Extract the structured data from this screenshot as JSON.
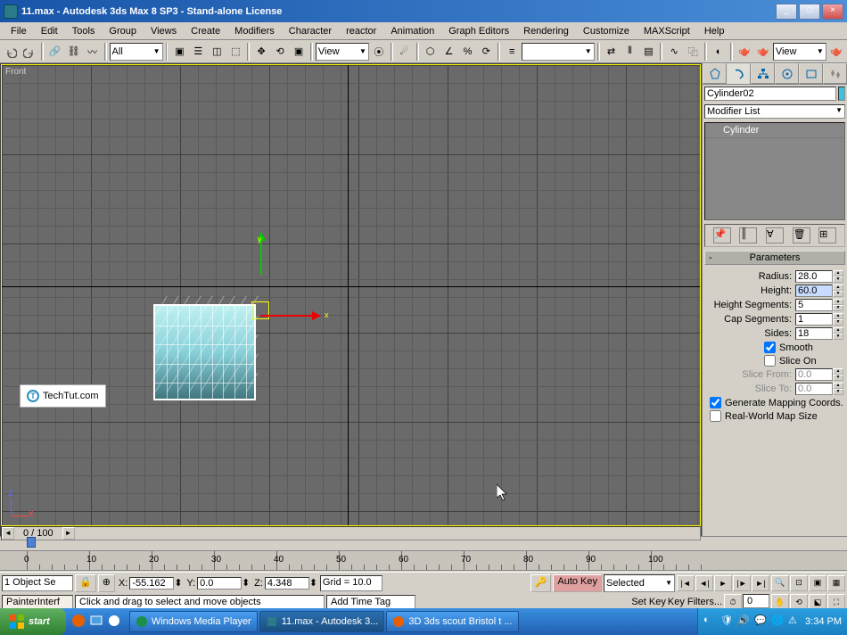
{
  "window": {
    "title": "11.max - Autodesk 3ds Max 8 SP3  - Stand-alone License"
  },
  "menu": [
    "File",
    "Edit",
    "Tools",
    "Group",
    "Views",
    "Create",
    "Modifiers",
    "Character",
    "reactor",
    "Animation",
    "Graph Editors",
    "Rendering",
    "Customize",
    "MAXScript",
    "Help"
  ],
  "toolbar": {
    "selection_filter": "All",
    "refcoord": "View",
    "view_mode": "View"
  },
  "viewport": {
    "label": "Front",
    "watermark": "TechTut.com"
  },
  "axis": {
    "x": "x",
    "y": "y",
    "z": "z"
  },
  "scrollbar": {
    "pos": "0 / 100"
  },
  "cmdpanel": {
    "object_name": "Cylinder02",
    "modifier_list_label": "Modifier List",
    "stack_item": "Cylinder",
    "rollout_title": "Parameters",
    "params": {
      "radius_lbl": "Radius:",
      "radius": "28.0",
      "height_lbl": "Height:",
      "height": "60.0",
      "hseg_lbl": "Height Segments:",
      "hseg": "5",
      "cseg_lbl": "Cap Segments:",
      "cseg": "1",
      "sides_lbl": "Sides:",
      "sides": "18",
      "smooth_lbl": "Smooth",
      "sliceon_lbl": "Slice On",
      "sfrom_lbl": "Slice From:",
      "sfrom": "0.0",
      "sto_lbl": "Slice To:",
      "sto": "0.0",
      "genmap_lbl": "Generate Mapping Coords.",
      "realworld_lbl": "Real-World Map Size"
    }
  },
  "timeline": {
    "ticks": [
      "0",
      "10",
      "20",
      "30",
      "40",
      "50",
      "60",
      "70",
      "80",
      "90",
      "100"
    ],
    "slider_label": "0 / 100"
  },
  "status": {
    "sel_info": "1 Object Se",
    "x_lbl": "X:",
    "x": "-55.162",
    "y_lbl": "Y:",
    "y": "0.0",
    "z_lbl": "Z:",
    "z": "4.348",
    "grid": "Grid = 10.0",
    "autokey": "Auto Key",
    "setkey": "Set Key",
    "selected": "Selected",
    "keyfilters": "Key Filters...",
    "script_listener": "PainterInterf",
    "hint": "Click and drag to select and move objects",
    "addtag": "Add Time Tag"
  },
  "taskbar": {
    "start": "start",
    "tasks": [
      {
        "label": "Windows Media Player"
      },
      {
        "label": "11.max - Autodesk 3..."
      },
      {
        "label": "3D 3ds scout Bristol t ..."
      }
    ],
    "clock": "3:34 PM"
  }
}
